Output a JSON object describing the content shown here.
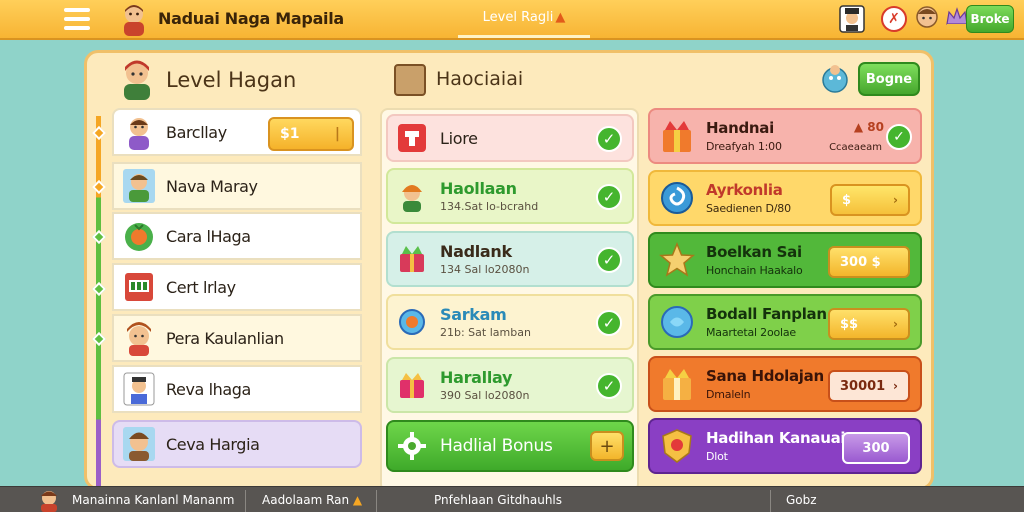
{
  "topbar": {
    "app_title": "Naduai Naga Mapaila",
    "center_tab": "Level Ragli",
    "right_button": "Broke",
    "icons": [
      "menu-icon",
      "avatar-icon",
      "chef-icon",
      "close-icon",
      "face-icon",
      "crown-icon"
    ]
  },
  "panel": {
    "left_title": "Level Hagan",
    "shop_title": "Haociaiai",
    "action_button": "Bogne"
  },
  "left_list": [
    {
      "name": "Barcllay",
      "pill": "$1"
    },
    {
      "name": "Nava Maray"
    },
    {
      "name": "Cara lHaga"
    },
    {
      "name": "Cert lrlay"
    },
    {
      "name": "Pera Kaulanlian"
    },
    {
      "name": "Reva lhaga"
    },
    {
      "name": "Ceva Hargia"
    }
  ],
  "mid_list": [
    {
      "title": "Liore",
      "sub": ""
    },
    {
      "title": "Haollaan",
      "sub": "134.Sat lo-bcrahd"
    },
    {
      "title": "Nadlank",
      "sub": "134 Sal lo2080n"
    },
    {
      "title": "Sarkam",
      "sub": "21b: Sat lamban"
    },
    {
      "title": "Harallay",
      "sub": "390 Sal lo2080n"
    },
    {
      "title": "Hadlial Bonus",
      "sub": ""
    }
  ],
  "right_list": [
    {
      "title": "Handnai",
      "sub": "Dreafyah 1:00",
      "badge": "80",
      "sub2": "Ccaeaeam"
    },
    {
      "title": "Ayrkonlia",
      "sub": "Saedienen D/80",
      "pill": "$"
    },
    {
      "title": "Boelkan Sai",
      "sub": "Honchain Haakalo",
      "pill": "300 $"
    },
    {
      "title": "Bodall Fanplan",
      "sub": "Maartetal 2oolae",
      "pill": "$$"
    },
    {
      "title": "Sana Hdolajan",
      "sub": "Dmaleln",
      "pill": "30001"
    },
    {
      "title": "Hadihan Kanauai",
      "sub": "Dlot",
      "pill": "300"
    }
  ],
  "bottombar": {
    "item1": "Manainna Kanlanl Mananm",
    "item2": "Aadolaam Ran",
    "item3": "Pnfehlaan Gitdhauhls",
    "item4": "Gobz"
  },
  "colors": {
    "topbar": "#f7b433",
    "panel_bg": "#fdeabc",
    "green": "#45a62d",
    "orange_row": "#f07a2c",
    "purple_row": "#8a3fc4",
    "red_row": "#f5a5a0"
  }
}
